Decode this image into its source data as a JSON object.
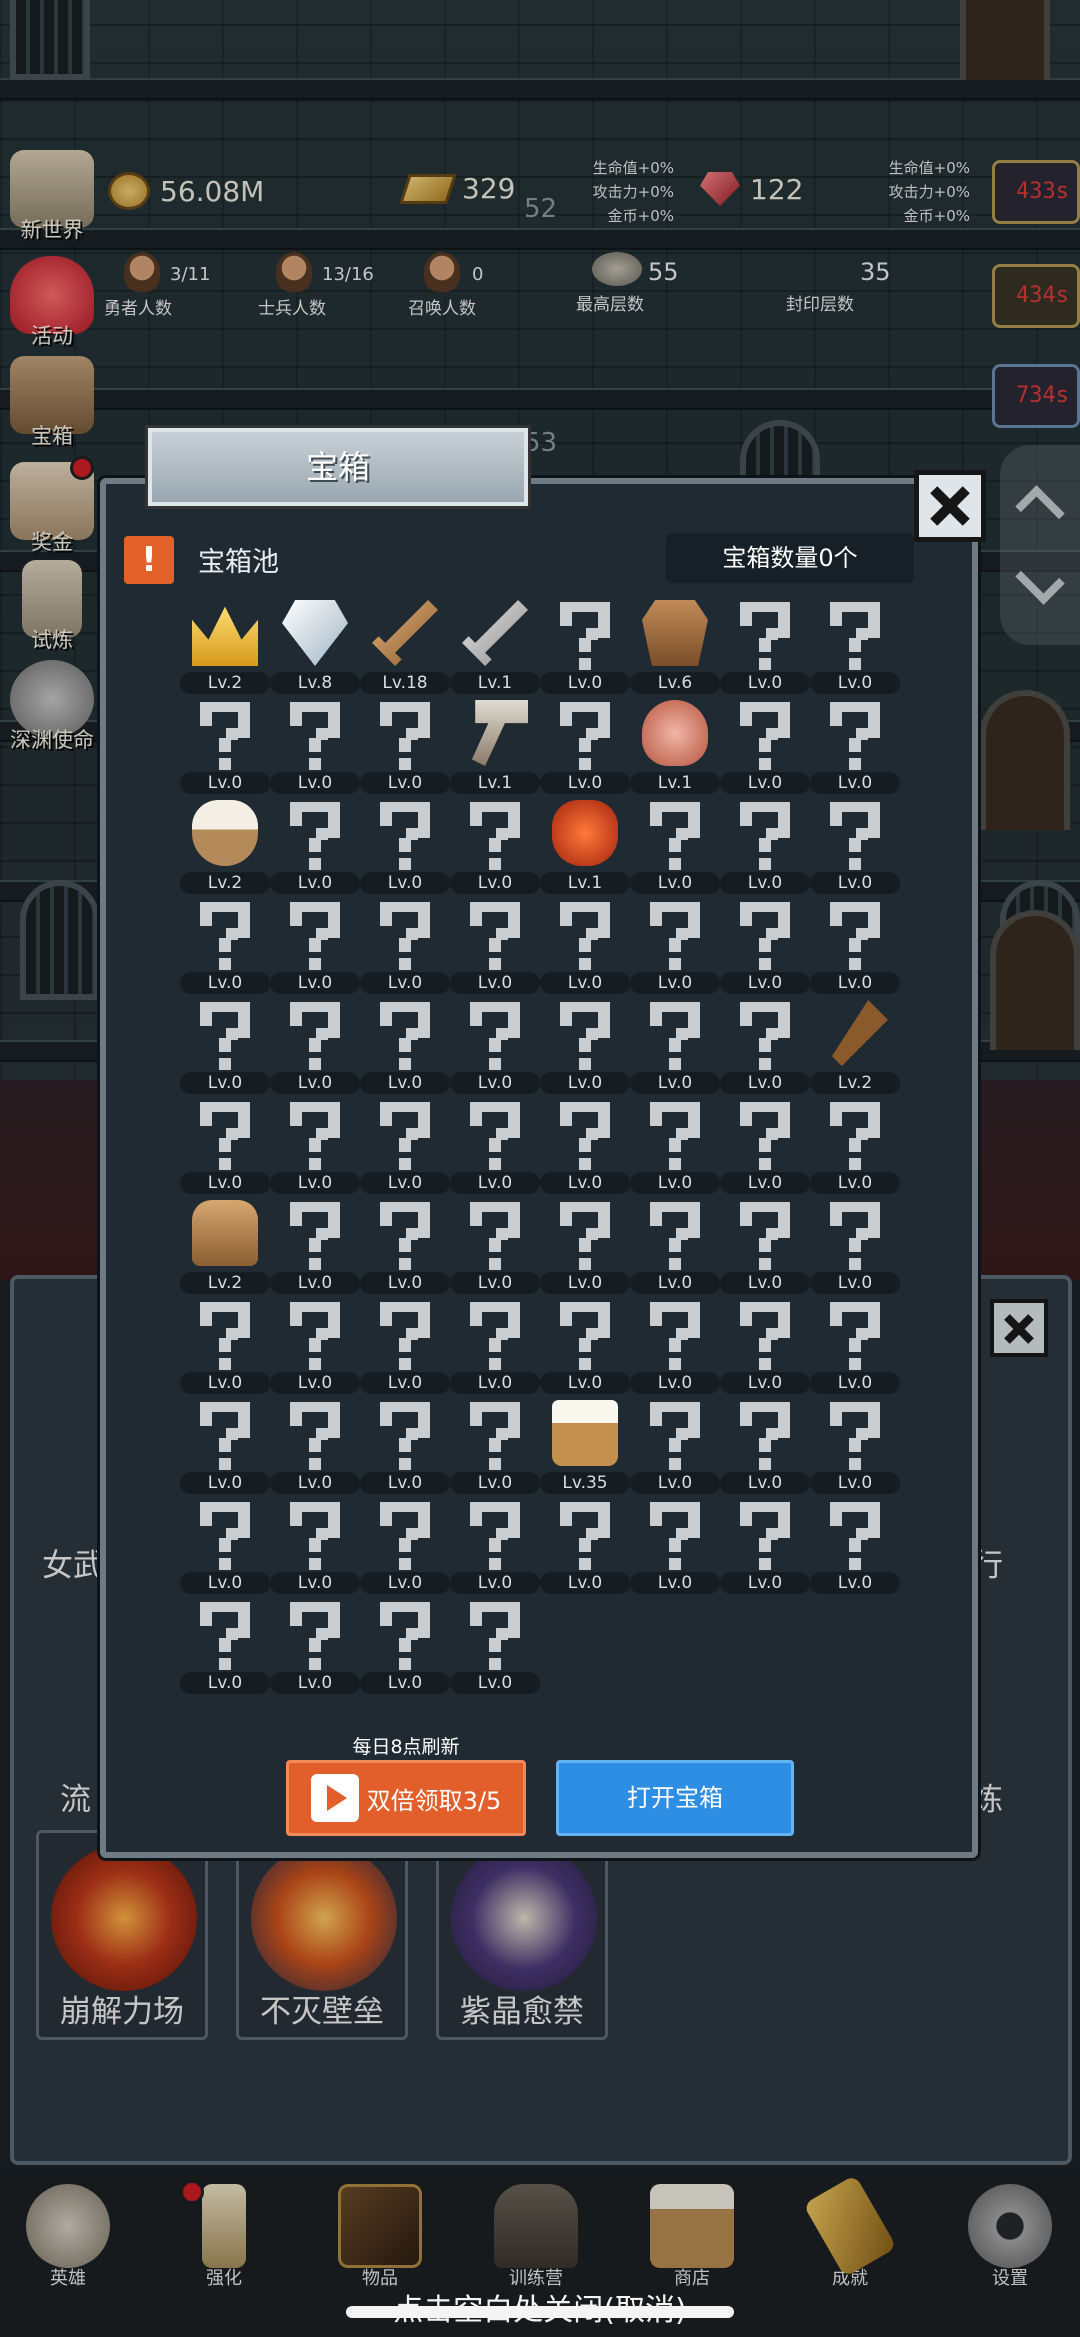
{
  "top_stats": {
    "gold": "56.08M",
    "gold_bar": "329",
    "gold_bar_sub": "52",
    "ruby": "122",
    "buff_left": [
      "生命值+0%",
      "攻击力+0%",
      "金币+0%"
    ],
    "buff_right": [
      "生命值+0%",
      "攻击力+0%",
      "金币+0%"
    ],
    "heroes_value": "3/11",
    "heroes_label": "勇者人数",
    "soldiers_value": "13/16",
    "soldiers_label": "士兵人数",
    "summons_value": "0",
    "summons_label": "召唤人数",
    "max_floor_value": "55",
    "max_floor_label": "最高层数",
    "sealed_floor_value": "35",
    "sealed_floor_label": "封印层数",
    "floor_dim": "53"
  },
  "side_menu": [
    "新世界",
    "活动",
    "宝箱",
    "奖金",
    "试炼",
    "深渊使命"
  ],
  "timers": [
    "433s",
    "434s",
    "734s"
  ],
  "dialog": {
    "title": "宝箱",
    "pool_label": "宝箱池",
    "chest_count": "宝箱数量0个",
    "refresh_note": "每日8点刷新",
    "double_button": "双倍领取3/5",
    "open_button": "打开宝箱",
    "items": [
      {
        "icon": "crown-icon",
        "level": "Lv.2"
      },
      {
        "icon": "diamond-icon",
        "level": "Lv.8"
      },
      {
        "icon": "wooden-sword-icon",
        "level": "Lv.18"
      },
      {
        "icon": "iron-sword-icon",
        "level": "Lv.1"
      },
      {
        "icon": "unknown-icon",
        "level": "Lv.0"
      },
      {
        "icon": "leather-armor-icon",
        "level": "Lv.6"
      },
      {
        "icon": "unknown-icon",
        "level": "Lv.0"
      },
      {
        "icon": "unknown-icon",
        "level": "Lv.0"
      },
      {
        "icon": "unknown-icon",
        "level": "Lv.0"
      },
      {
        "icon": "unknown-icon",
        "level": "Lv.0"
      },
      {
        "icon": "unknown-icon",
        "level": "Lv.0"
      },
      {
        "icon": "hammer-icon",
        "level": "Lv.1"
      },
      {
        "icon": "unknown-icon",
        "level": "Lv.0"
      },
      {
        "icon": "ham-icon",
        "level": "Lv.1"
      },
      {
        "icon": "unknown-icon",
        "level": "Lv.0"
      },
      {
        "icon": "unknown-icon",
        "level": "Lv.0"
      },
      {
        "icon": "bowl-icon",
        "level": "Lv.2"
      },
      {
        "icon": "unknown-icon",
        "level": "Lv.0"
      },
      {
        "icon": "unknown-icon",
        "level": "Lv.0"
      },
      {
        "icon": "unknown-icon",
        "level": "Lv.0"
      },
      {
        "icon": "potion-icon",
        "level": "Lv.1"
      },
      {
        "icon": "unknown-icon",
        "level": "Lv.0"
      },
      {
        "icon": "unknown-icon",
        "level": "Lv.0"
      },
      {
        "icon": "unknown-icon",
        "level": "Lv.0"
      },
      {
        "icon": "unknown-icon",
        "level": "Lv.0"
      },
      {
        "icon": "unknown-icon",
        "level": "Lv.0"
      },
      {
        "icon": "unknown-icon",
        "level": "Lv.0"
      },
      {
        "icon": "unknown-icon",
        "level": "Lv.0"
      },
      {
        "icon": "unknown-icon",
        "level": "Lv.0"
      },
      {
        "icon": "unknown-icon",
        "level": "Lv.0"
      },
      {
        "icon": "unknown-icon",
        "level": "Lv.0"
      },
      {
        "icon": "unknown-icon",
        "level": "Lv.0"
      },
      {
        "icon": "unknown-icon",
        "level": "Lv.0"
      },
      {
        "icon": "unknown-icon",
        "level": "Lv.0"
      },
      {
        "icon": "unknown-icon",
        "level": "Lv.0"
      },
      {
        "icon": "unknown-icon",
        "level": "Lv.0"
      },
      {
        "icon": "unknown-icon",
        "level": "Lv.0"
      },
      {
        "icon": "unknown-icon",
        "level": "Lv.0"
      },
      {
        "icon": "unknown-icon",
        "level": "Lv.0"
      },
      {
        "icon": "torch-icon",
        "level": "Lv.2"
      },
      {
        "icon": "unknown-icon",
        "level": "Lv.0"
      },
      {
        "icon": "unknown-icon",
        "level": "Lv.0"
      },
      {
        "icon": "unknown-icon",
        "level": "Lv.0"
      },
      {
        "icon": "unknown-icon",
        "level": "Lv.0"
      },
      {
        "icon": "unknown-icon",
        "level": "Lv.0"
      },
      {
        "icon": "unknown-icon",
        "level": "Lv.0"
      },
      {
        "icon": "unknown-icon",
        "level": "Lv.0"
      },
      {
        "icon": "unknown-icon",
        "level": "Lv.0"
      },
      {
        "icon": "backpack-icon",
        "level": "Lv.2"
      },
      {
        "icon": "unknown-icon",
        "level": "Lv.0"
      },
      {
        "icon": "unknown-icon",
        "level": "Lv.0"
      },
      {
        "icon": "unknown-icon",
        "level": "Lv.0"
      },
      {
        "icon": "unknown-icon",
        "level": "Lv.0"
      },
      {
        "icon": "unknown-icon",
        "level": "Lv.0"
      },
      {
        "icon": "unknown-icon",
        "level": "Lv.0"
      },
      {
        "icon": "unknown-icon",
        "level": "Lv.0"
      },
      {
        "icon": "unknown-icon",
        "level": "Lv.0"
      },
      {
        "icon": "unknown-icon",
        "level": "Lv.0"
      },
      {
        "icon": "unknown-icon",
        "level": "Lv.0"
      },
      {
        "icon": "unknown-icon",
        "level": "Lv.0"
      },
      {
        "icon": "unknown-icon",
        "level": "Lv.0"
      },
      {
        "icon": "unknown-icon",
        "level": "Lv.0"
      },
      {
        "icon": "unknown-icon",
        "level": "Lv.0"
      },
      {
        "icon": "unknown-icon",
        "level": "Lv.0"
      },
      {
        "icon": "unknown-icon",
        "level": "Lv.0"
      },
      {
        "icon": "unknown-icon",
        "level": "Lv.0"
      },
      {
        "icon": "unknown-icon",
        "level": "Lv.0"
      },
      {
        "icon": "unknown-icon",
        "level": "Lv.0"
      },
      {
        "icon": "beer-mug-icon",
        "level": "Lv.35"
      },
      {
        "icon": "unknown-icon",
        "level": "Lv.0"
      },
      {
        "icon": "unknown-icon",
        "level": "Lv.0"
      },
      {
        "icon": "unknown-icon",
        "level": "Lv.0"
      },
      {
        "icon": "unknown-icon",
        "level": "Lv.0"
      },
      {
        "icon": "unknown-icon",
        "level": "Lv.0"
      },
      {
        "icon": "unknown-icon",
        "level": "Lv.0"
      },
      {
        "icon": "unknown-icon",
        "level": "Lv.0"
      },
      {
        "icon": "unknown-icon",
        "level": "Lv.0"
      },
      {
        "icon": "unknown-icon",
        "level": "Lv.0"
      },
      {
        "icon": "unknown-icon",
        "level": "Lv.0"
      },
      {
        "icon": "unknown-icon",
        "level": "Lv.0"
      },
      {
        "icon": "unknown-icon",
        "level": "Lv.0"
      },
      {
        "icon": "unknown-icon",
        "level": "Lv.0"
      },
      {
        "icon": "unknown-icon",
        "level": "Lv.0"
      },
      {
        "icon": "unknown-icon",
        "level": "Lv.0"
      }
    ]
  },
  "under_panel": {
    "skills": [
      "崩解力场",
      "不灭壁垒",
      "紫晶愈禁"
    ],
    "edge_labels": [
      "女武",
      "流",
      "行",
      "炼"
    ]
  },
  "bottom_nav": [
    "英雄",
    "强化",
    "物品",
    "训练营",
    "商店",
    "成就",
    "设置"
  ],
  "close_hint": "点击空白处关闭(取消)",
  "colors": {
    "accent_orange": "#e25f2b",
    "accent_blue": "#2e8ee3",
    "timer_red": "#e03a3a"
  }
}
